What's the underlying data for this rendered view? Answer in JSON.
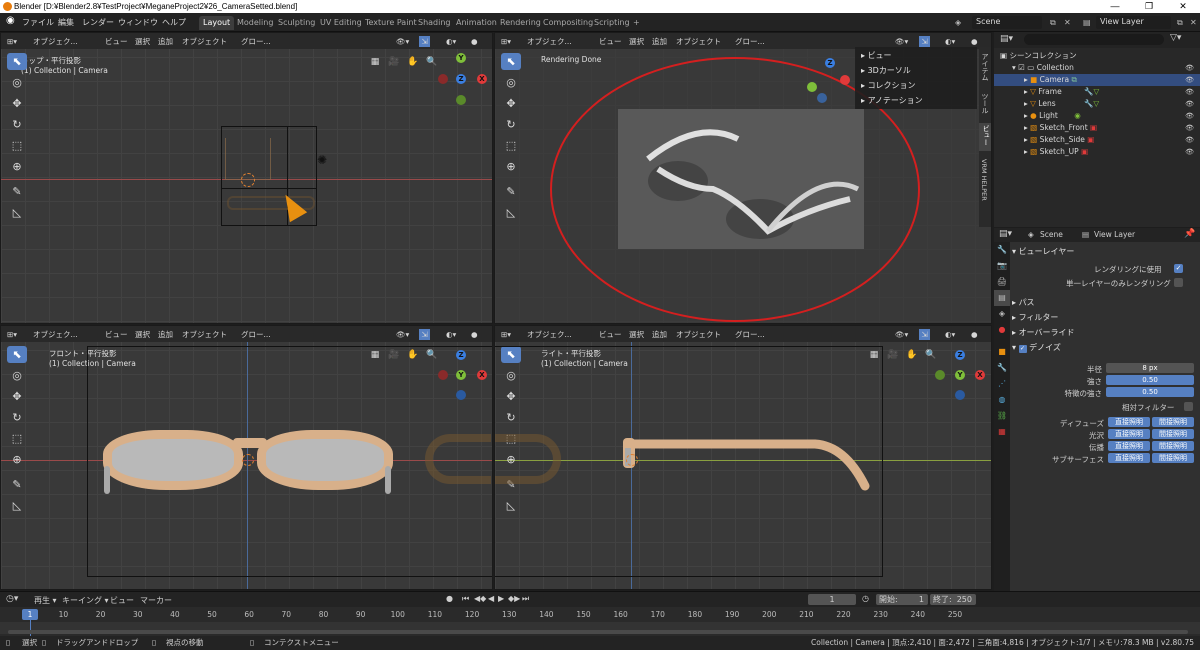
{
  "window": {
    "title": "Blender [D:¥Blender2.8¥TestProject¥MeganeProject2¥26_CameraSetted.blend]",
    "minimize": "—",
    "maximize": "❐",
    "close": "✕"
  },
  "menu": {
    "items": [
      "ファイル",
      "編集",
      "レンダー",
      "ウィンドウ",
      "ヘルプ"
    ],
    "workspaces": [
      "Layout",
      "Modeling",
      "Sculpting",
      "UV Editing",
      "Texture Paint",
      "Shading",
      "Animation",
      "Rendering",
      "Compositing",
      "Scripting",
      "+"
    ],
    "scene_label": "Scene",
    "view_layer_label": "View Layer"
  },
  "viewport_header": {
    "mode": "オブジェク...",
    "view": "ビュー",
    "select": "選択",
    "add": "追加",
    "object": "オブジェクト",
    "transform": "グロー..."
  },
  "viewports": {
    "top": {
      "label1": "トップ・平行投影",
      "label2": "(1) Collection | Camera"
    },
    "render": {
      "label1": "Rendering Done"
    },
    "front": {
      "label1": "フロント・平行投影",
      "label2": "(1) Collection | Camera"
    },
    "right": {
      "label1": "ライト・平行投影",
      "label2": "(1) Collection | Camera"
    }
  },
  "render_panel": {
    "items": [
      "ビュー",
      "3Dカーソル",
      "コレクション",
      "アノテーション"
    ],
    "side_tabs": [
      "アイテム",
      "ツール",
      "ビュー",
      "VRM HELPER"
    ]
  },
  "outliner": {
    "root": "シーンコレクション",
    "collection": "Collection",
    "items": [
      "Camera",
      "Frame",
      "Lens",
      "Light",
      "Sketch_Front",
      "Sketch_Side",
      "Sketch_UP"
    ]
  },
  "properties": {
    "scene_tab": "Scene",
    "view_layer_tab": "View Layer",
    "view_layer_section": "ビューレイヤー",
    "use_for_render": "レンダリングに使用",
    "single_layer": "単一レイヤーのみレンダリング",
    "sections": [
      "パス",
      "フィルター",
      "オーバーライド",
      "デノイズ"
    ],
    "denoise": {
      "radius_label": "半径",
      "radius_value": "8 px",
      "strength_label": "強さ",
      "strength_value": "0.50",
      "feature_label": "特徴の強さ",
      "feature_value": "0.50",
      "relative_filter": "相対フィルター"
    },
    "light_rows": [
      {
        "label": "ディフューズ",
        "a": "直接照明",
        "b": "間接照明"
      },
      {
        "label": "光沢",
        "a": "直接照明",
        "b": "間接照明"
      },
      {
        "label": "伝播",
        "a": "直接照明",
        "b": "間接照明"
      },
      {
        "label": "サブサーフェス",
        "a": "直接照明",
        "b": "間接照明"
      }
    ]
  },
  "timeline": {
    "menu": [
      "再生",
      "キーイング",
      "ビュー",
      "マーカー"
    ],
    "current_frame": "1",
    "start_label": "開始:",
    "start_value": "1",
    "end_label": "終了:",
    "end_value": "250",
    "ticks": [
      "1",
      "10",
      "20",
      "30",
      "40",
      "50",
      "60",
      "70",
      "80",
      "90",
      "100",
      "110",
      "120",
      "130",
      "140",
      "150",
      "160",
      "170",
      "180",
      "190",
      "200",
      "210",
      "220",
      "230",
      "240",
      "250"
    ]
  },
  "status": {
    "select": "選択",
    "drag": "ドラッグアンドドロップ",
    "move_view": "視点の移動",
    "context_menu": "コンテクストメニュー",
    "stats": "Collection | Camera | 頂点:2,410 | 面:2,472 | 三角面:4,816 | オブジェクト:1/7 | メモリ:78.3 MB | v2.80.75"
  },
  "colors": {
    "accent": "#5680c2",
    "annotation_circle": "#d41f1f",
    "glasses_frame": "#d8b08a",
    "axis_x": "#e03a3a",
    "axis_y": "#7fbf3a",
    "axis_z": "#3a7ee0"
  }
}
